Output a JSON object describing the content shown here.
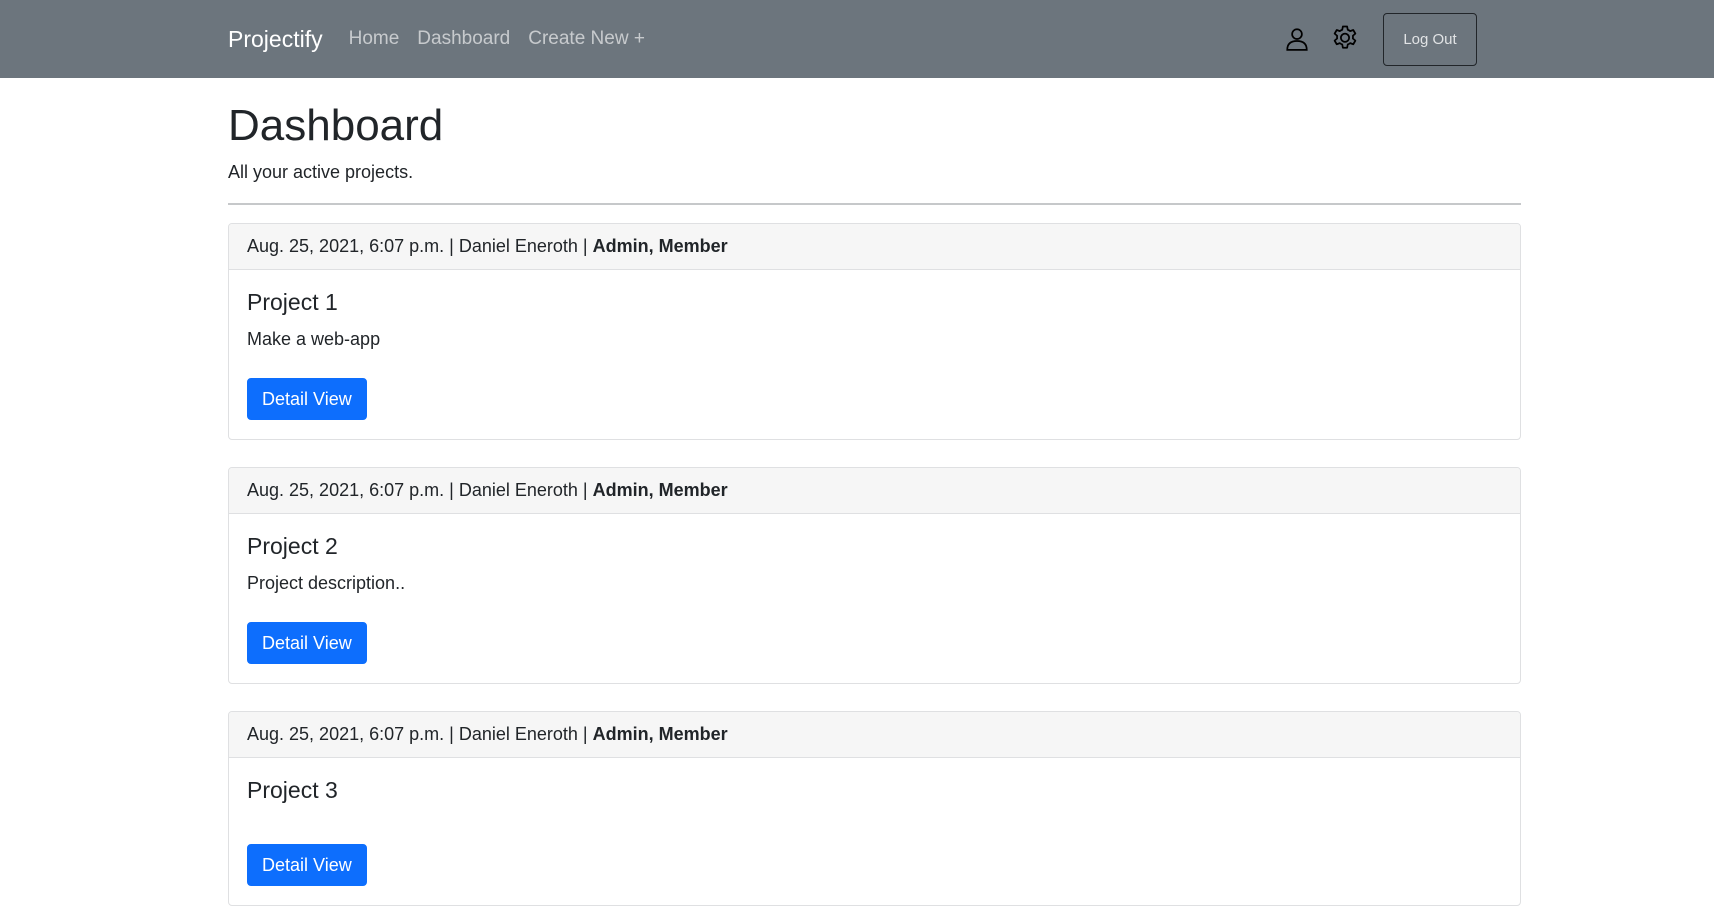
{
  "navbar": {
    "brand": "Projectify",
    "links": [
      "Home",
      "Dashboard",
      "Create New +"
    ],
    "icons": [
      "user-icon",
      "gear-icon"
    ],
    "logout_label": "Log Out",
    "background": "#6c757d"
  },
  "page": {
    "title": "Dashboard",
    "subtitle": "All your active projects."
  },
  "projects": [
    {
      "meta": "Aug. 25, 2021, 6:07 p.m. | Daniel Eneroth | ",
      "roles": "Admin, Member",
      "title": "Project 1",
      "description": "Make a web-app",
      "button_label": "Detail View"
    },
    {
      "meta": "Aug. 25, 2021, 6:07 p.m. | Daniel Eneroth | ",
      "roles": "Admin, Member",
      "title": "Project 2",
      "description": "Project description..",
      "button_label": "Detail View"
    },
    {
      "meta": "Aug. 25, 2021, 6:07 p.m. | Daniel Eneroth | ",
      "roles": "Admin, Member",
      "title": "Project 3",
      "description": "",
      "button_label": "Detail View"
    }
  ],
  "colors": {
    "primary_button": "#0d6efd",
    "card_header_bg": "#f6f6f6"
  }
}
